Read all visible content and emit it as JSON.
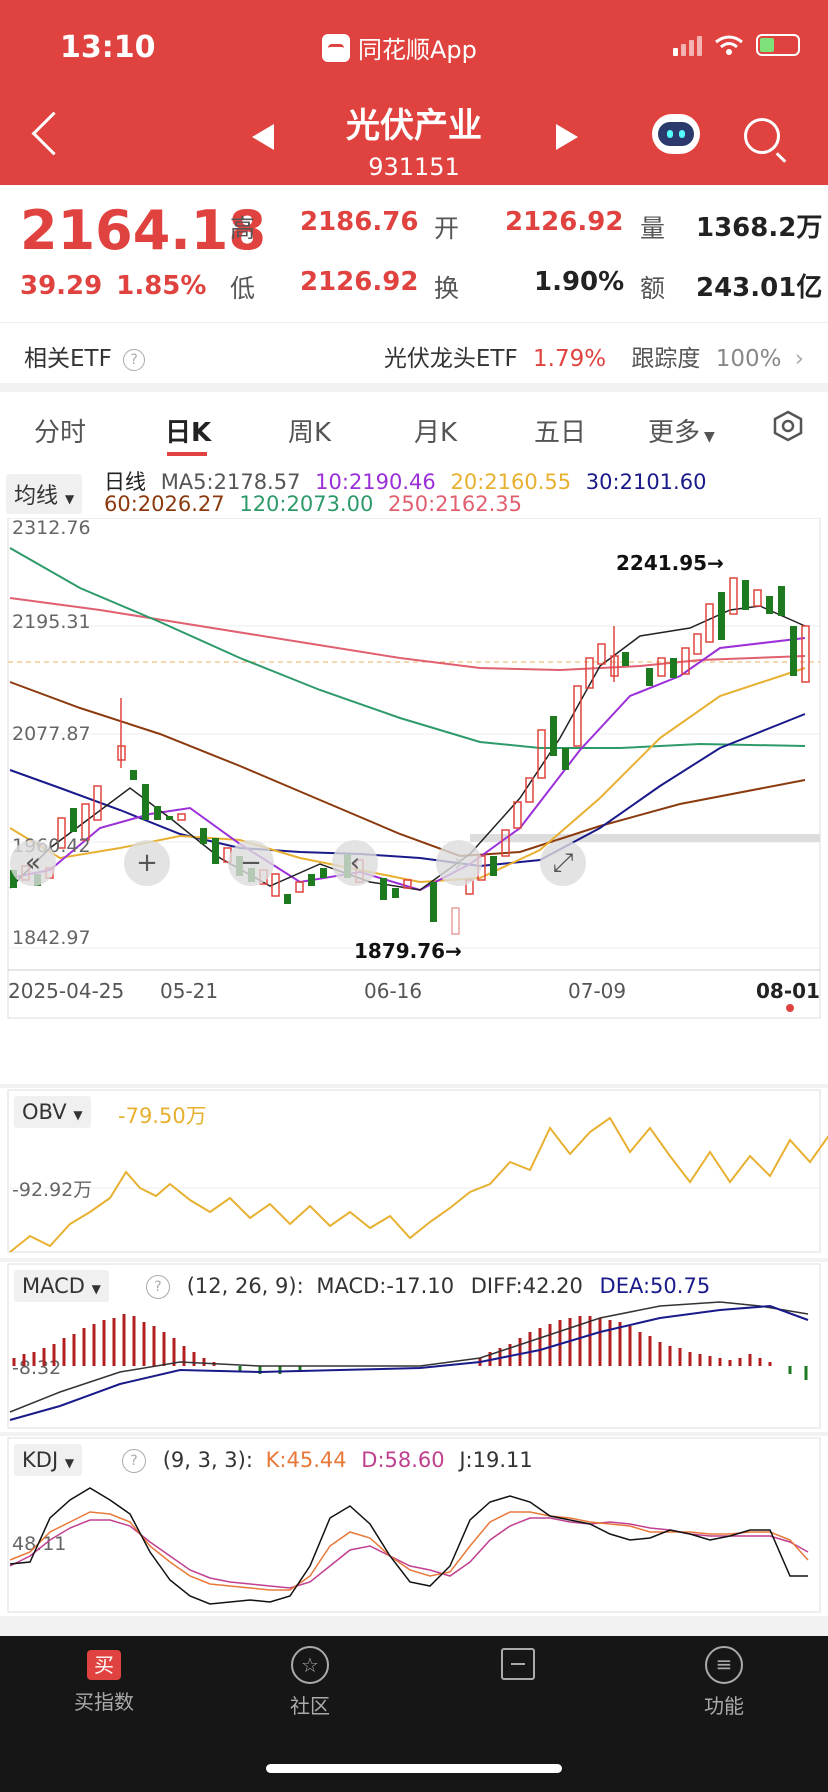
{
  "status": {
    "time": "13:10",
    "app_name": "同花顺App"
  },
  "header": {
    "title": "光伏产业",
    "code": "931151"
  },
  "quote": {
    "price": "2164.18",
    "change": "39.29",
    "change_pct": "1.85%",
    "high_label": "高",
    "high": "2186.76",
    "open_label": "开",
    "open": "2126.92",
    "vol_label": "量",
    "vol": "1368.2万",
    "low_label": "低",
    "low": "2126.92",
    "turn_label": "换",
    "turn": "1.90%",
    "amt_label": "额",
    "amt": "243.01亿"
  },
  "etf": {
    "left_label": "相关ETF",
    "name": "光伏龙头ETF",
    "pct": "1.79%",
    "track_label": "跟踪度",
    "track": "100%"
  },
  "tabs": [
    "分时",
    "日K",
    "周K",
    "月K",
    "五日",
    "更多"
  ],
  "kchart": {
    "ma_button": "均线",
    "line_label": "日线",
    "ma5": "MA5:2178.57",
    "ma10": "10:2190.46",
    "ma20": "20:2160.55",
    "ma30": "30:2101.60",
    "ma60": "60:2026.27",
    "ma120": "120:2073.00",
    "ma250": "250:2162.35",
    "y_labels": [
      "2312.76",
      "2195.31",
      "2077.87",
      "1960.42",
      "1842.97"
    ],
    "x_labels": [
      "2025-04-25",
      "05-21",
      "06-16",
      "07-09",
      "08-01"
    ],
    "high_mark": "2241.95→",
    "low_mark": "1879.76→"
  },
  "obv": {
    "name": "OBV",
    "value": "-79.50万",
    "y_label": "-92.92万"
  },
  "macd": {
    "name": "MACD",
    "params": "(12, 26, 9):",
    "macd": "MACD:-17.10",
    "diff": "DIFF:42.20",
    "dea": "DEA:50.75",
    "y_label": "-8.32"
  },
  "kdj": {
    "name": "KDJ",
    "params": "(9, 3, 3):",
    "k": "K:45.44",
    "d": "D:58.60",
    "j": "J:19.11",
    "y_label": "48.11"
  },
  "nav": {
    "items": [
      "买指数",
      "社区",
      "",
      "功能"
    ]
  },
  "colors": {
    "red": "#e0433f",
    "green": "#1e7a1e",
    "ma5": "#222222",
    "ma10": "#9b30d9",
    "ma20": "#e8b030",
    "ma30": "#1a1a8a",
    "ma60": "#8b3a0e",
    "ma120": "#2e9a6a",
    "ma250": "#e06070"
  }
}
